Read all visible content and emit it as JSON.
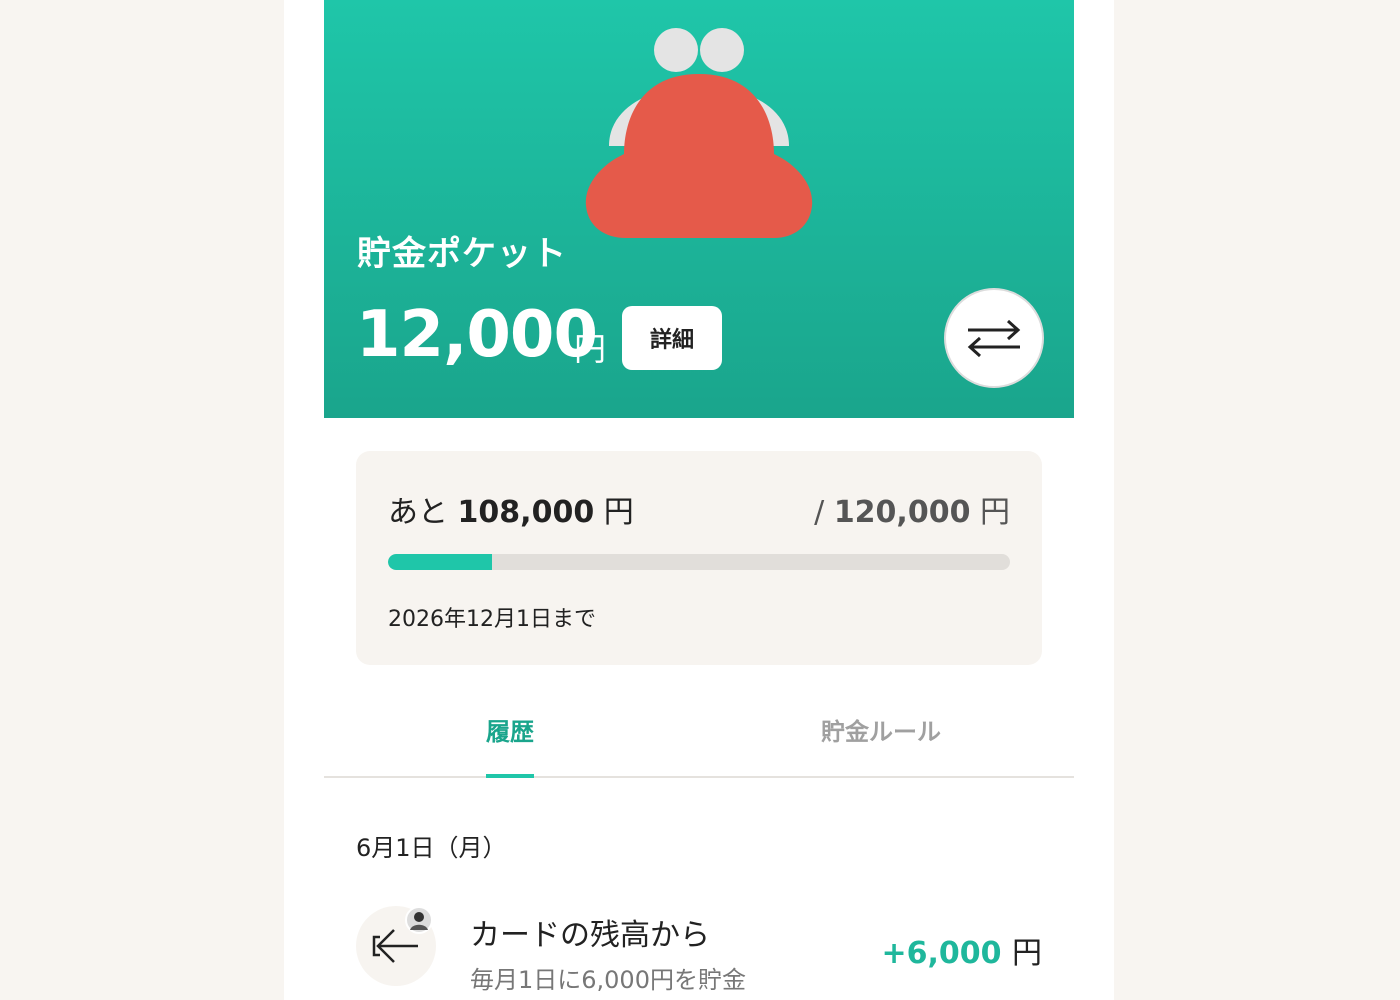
{
  "pocket": {
    "title": "貯金ポケット",
    "amount": "12,000",
    "unit": "円",
    "detail_label": "詳細"
  },
  "goal": {
    "remain_prefix": "あと",
    "remain_amount": "108,000",
    "remain_unit": "円",
    "target_prefix": "/",
    "target_amount": "120,000",
    "target_unit": "円",
    "progress_fraction": 0.1667,
    "deadline": "2026年12月1日まで"
  },
  "tabs": [
    {
      "label": "履歴",
      "active": true
    },
    {
      "label": "貯金ルール",
      "active": false
    }
  ],
  "history": {
    "date": "6月1日（月）",
    "items": [
      {
        "icon": "arrow-left-icon",
        "title": "カードの残高から",
        "subtitle": "毎月1日に6,000円を貯金",
        "amount": "+6,000",
        "unit": "円"
      }
    ]
  },
  "colors": {
    "accent": "#1fc6a9",
    "purse": "#e55a4a"
  },
  "icons": {
    "purse": "coin-purse-icon",
    "transfer": "swap-arrows-icon"
  }
}
